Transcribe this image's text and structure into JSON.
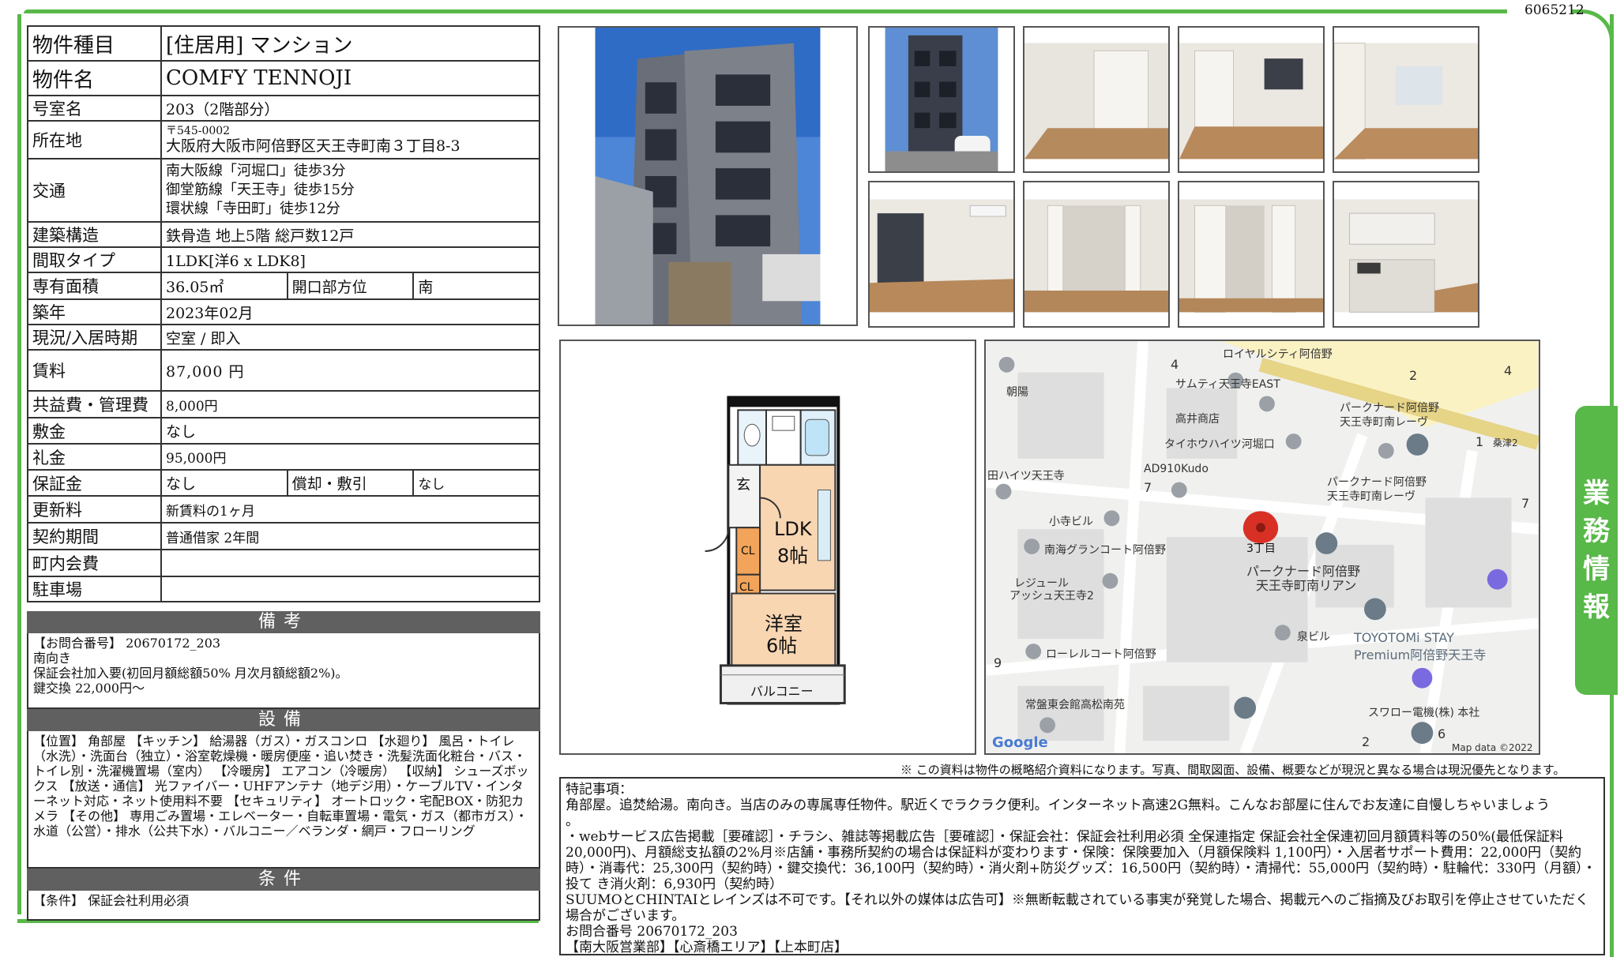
{
  "doc_id": "6065212",
  "property": {
    "type_label": "物件種目",
    "type_value": "[住居用] マンション",
    "name_label": "物件名",
    "name_value": "COMFY TENNOJI",
    "room_label": "号室名",
    "room_value": "203（2階部分）",
    "address_label": "所在地",
    "postal": "〒545-0002",
    "address": "大阪府大阪市阿倍野区天王寺町南３丁目8-3",
    "transit_label": "交通",
    "transit": [
      "南大阪線「河堀口」徒歩3分",
      "御堂筋線「天王寺」徒歩15分",
      "環状線「寺田町」徒歩12分"
    ],
    "structure_label": "建築構造",
    "structure_value": "鉄骨造 地上5階 総戸数12戸",
    "layout_label": "間取タイプ",
    "layout_value": "1LDK[洋6 x LDK8]",
    "area_label": "専有面積",
    "area_value": "36.05㎡",
    "direction_label": "開口部方位",
    "direction_value": "南",
    "built_label": "築年",
    "built_value": "2023年02月",
    "status_label": "現況/入居時期",
    "status_value": "空室 / 即入",
    "rent_label": "賃料",
    "rent_value": "87,000 円",
    "fee_label": "共益費・管理費",
    "fee_value": "8,000円",
    "deposit_label": "敷金",
    "deposit_value": "なし",
    "key_money_label": "礼金",
    "key_money_value": "95,000円",
    "guarantee_label": "保証金",
    "guarantee_value": "なし",
    "amort_label": "償却・敷引",
    "amort_value": "なし",
    "renewal_label": "更新料",
    "renewal_value": "新賃料の1ヶ月",
    "contract_label": "契約期間",
    "contract_value": "普通借家 2年間",
    "community_label": "町内会費",
    "community_value": "",
    "parking_label": "駐車場",
    "parking_value": ""
  },
  "remarks": {
    "title": "備考",
    "lines": [
      "【お問合番号】 20670172_203",
      "南向き",
      "保証会社加入要(初回月額総額50% 月次月額総額2%)。",
      "鍵交換 22,000円〜"
    ]
  },
  "facilities": {
    "title": "設備",
    "text": "【位置】 角部屋 【キッチン】 給湯器（ガス）・ガスコンロ 【水廻り】 風呂・トイレ（水洗）・洗面台（独立）・浴室乾燥機・暖房便座・追い焚き・洗髪洗面化粧台・バス・トイレ別・洗濯機置場（室内） 【冷暖房】 エアコン（冷暖房） 【収納】 シューズボックス 【放送・通信】 光ファイバー・UHFアンテナ（地デジ用）・ケーブルTV・インターネット対応・ネット使用料不要 【セキュリティ】 オートロック・宅配BOX・防犯カメラ 【その他】 専用ごみ置場・エレベーター・自転車置場・電気・ガス（都市ガス）・水道（公営）・排水（公共下水）・バルコニー／ベランダ・網戸・フローリング"
  },
  "conditions": {
    "title": "条件",
    "text": "【条件】 保証会社利用必須"
  },
  "floorplan": {
    "rooms": [
      "玄",
      "LDK",
      "8帖",
      "洋室",
      "6帖",
      "CL",
      "CL",
      "バルコニー"
    ]
  },
  "map": {
    "labels": [
      "ロイヤルシティ阿倍野",
      "サムティ天王寺EAST",
      "高井商店",
      "タイホウハイツ河堀口",
      "パークナード阿倍野",
      "天王寺町南レーヴ",
      "パークナード阿倍野",
      "天王寺町南レーヴ",
      "AD910Kudo",
      "田ハイツ天王寺",
      "小寺ビル",
      "南海グランコート阿倍野",
      "3丁目",
      "パークナード阿倍野",
      "天王寺町南リアン",
      "レジュール",
      "アッシュ天王寺2",
      "泉ビル",
      "TOYOTOMi STAY",
      "Premium阿倍野天王寺",
      "ローレルコート阿倍野",
      "常盤東会館高松南苑",
      "スワロー電機(株) 本社",
      "朝陽",
      "桑津2",
      "Google",
      "Map data ©2022"
    ],
    "numbers": [
      "4",
      "2",
      "4",
      "1",
      "7",
      "7",
      "9",
      "2",
      "6"
    ],
    "pin_color": "#d93025"
  },
  "note": "※ この資料は物件の概略紹介資料になります。写真、間取図面、設備、概要などが現況と異なる場合は現況優先となります。",
  "special": {
    "lines": [
      "特記事項：",
      "角部屋。追焚給湯。南向き。当店のみの専属専任物件。駅近くでラクラク便利。インターネット高速2G無料。こんなお部屋に住んでお友達に自慢しちゃいましょう",
      "。",
      "・webサービス広告掲載［要確認］・チラシ、雑誌等掲載広告［要確認］・保証会社：保証会社利用必須 全保連指定 保証会社全保連初回月額賃料等の50%(最低保証料20,000円)、月額総支払額の2%月※店舗・事務所契約の場合は保証料が変わります・保険：保険要加入（月額保険料 1,100円）・入居者サポート費用：22,000円（契約時）・消毒代：25,300円（契約時）・鍵交換代：36,100円（契約時）・消火剤+防災グッズ：16,500円（契約時）・清掃代：55,000円（契約時）・駐輪代：330円（月額）・投て き消火剤：6,930円（契約時）",
      "SUUMOとCHINTAIとレインズは不可です。【それ以外の媒体は広告可】※無断転載されている事実が発覚した場合、掲載元へのご指摘及びお取引を停止させていただく場合がございます。",
      "お問合番号 20670172_203",
      "【南大阪営業部】【心斎橋エリア】【上本町店】"
    ]
  },
  "side_tab": [
    "業",
    "務",
    "情",
    "報"
  ],
  "colors": {
    "accent": "#58b848",
    "header_gray": "#606060"
  }
}
